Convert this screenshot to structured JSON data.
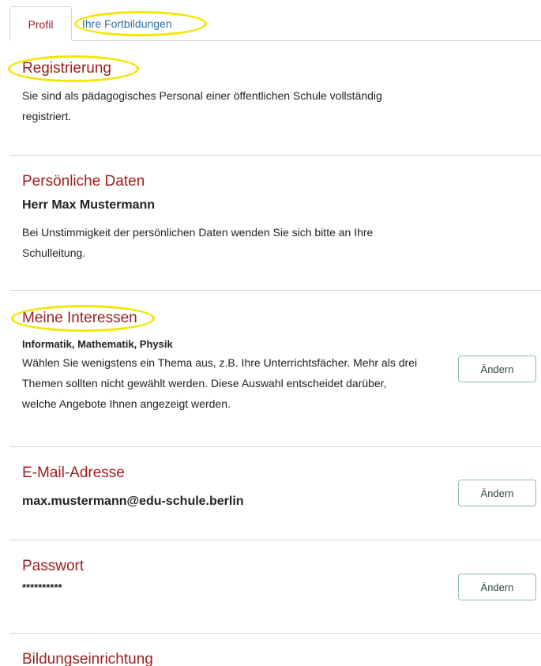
{
  "tabs": [
    {
      "label": "Profil",
      "active": true
    },
    {
      "label": "Ihre Fortbildungen",
      "active": false
    }
  ],
  "sections": {
    "registrierung": {
      "title": "Registrierung",
      "text": "Sie sind als pädagogisches Personal einer öffentlichen Schule vollständig registriert."
    },
    "persoenliche_daten": {
      "title": "Persönliche Daten",
      "name": "Herr Max Mustermann",
      "text": "Bei Unstimmigkeit der persönlichen Daten wenden Sie sich bitte an Ihre Schulleitung."
    },
    "interessen": {
      "title": "Meine Interessen",
      "topics": "Informatik, Mathematik, Physik",
      "text": "Wählen Sie wenigstens ein Thema aus, z.B. Ihre Unterrichtsfächer. Mehr als drei Themen sollten nicht gewählt werden. Diese Auswahl entscheidet darüber, welche Angebote Ihnen angezeigt werden.",
      "button": "Ändern"
    },
    "email": {
      "title": "E-Mail-Adresse",
      "value": "max.mustermann@edu-schule.berlin",
      "button": "Ändern"
    },
    "passwort": {
      "title": "Passwort",
      "value": "**********",
      "button": "Ändern"
    },
    "bildungseinrichtung": {
      "title": "Bildungseinrichtung"
    }
  },
  "colors": {
    "heading": "#9b1c1c",
    "link": "#2e6da4",
    "highlight": "#f5e600",
    "button_border": "#8bbfa8"
  }
}
